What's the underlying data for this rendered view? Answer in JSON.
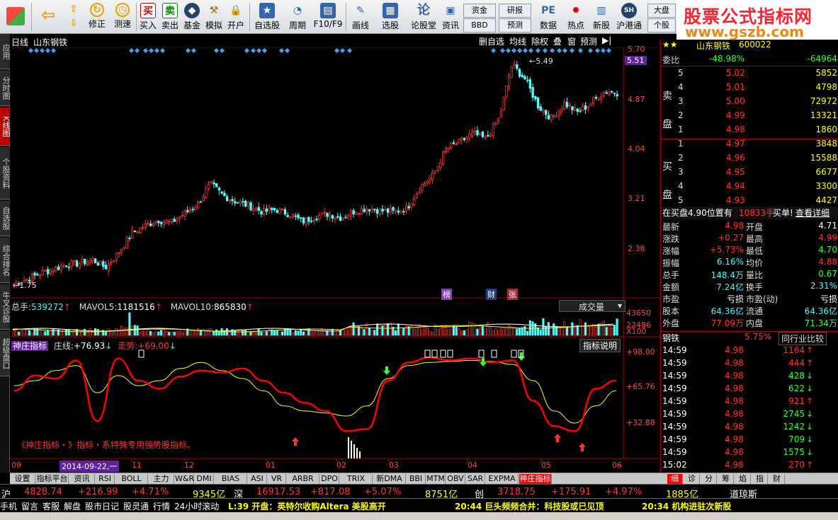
{
  "toolbar": {
    "items": [
      {
        "label": "修正",
        "icon": "refresh-icon"
      },
      {
        "label": "测速",
        "icon": "clock-icon"
      },
      {
        "label": "买入",
        "icon": "buy-icon",
        "glyph": "买"
      },
      {
        "label": "卖出",
        "icon": "sell-icon",
        "glyph": "卖"
      },
      {
        "label": "基金",
        "icon": "fund-icon"
      },
      {
        "label": "模拟",
        "icon": "hammer-icon"
      },
      {
        "label": "开户",
        "icon": "lock-icon"
      },
      {
        "label": "自选股",
        "icon": "star-icon"
      },
      {
        "label": "周期",
        "icon": "cycle-icon"
      },
      {
        "label": "F10/F9",
        "icon": "f10-icon"
      },
      {
        "label": "画线",
        "icon": "pen-icon"
      },
      {
        "label": "选股",
        "icon": "select-icon"
      },
      {
        "label": "论股堂",
        "icon": "forum-icon",
        "glyph": "论"
      },
      {
        "label": "资讯",
        "icon": "news-icon"
      },
      {
        "label": "数据",
        "icon": "data-icon"
      },
      {
        "label": "热点",
        "icon": "hot-icon"
      },
      {
        "label": "新股",
        "icon": "newstock-icon"
      },
      {
        "label": "沪港通",
        "icon": "hk-icon"
      }
    ],
    "small_buttons": {
      "zijin": "资金",
      "bbd": "BBD",
      "yanbao": "研报",
      "yuce": "预测",
      "dapan": "大盘",
      "gegu": "个股"
    }
  },
  "ad": {
    "title": "股票公式指标网",
    "url": "www.gszb.com"
  },
  "side_tabs": [
    "应用",
    "分时图",
    "K线图",
    "个股资料",
    "自选股",
    "综合排名",
    "牛叉诊股",
    "超级盘口"
  ],
  "chart": {
    "header": {
      "period": "日线",
      "stock_name": "山东钢铁",
      "buttons": [
        "删自选",
        "均线",
        "除权",
        "叠",
        "窗",
        "预测"
      ]
    },
    "price_ticks": [
      "5.70",
      "4.87",
      "4.04",
      "3.21",
      "2.38"
    ],
    "price_flag": "5.51",
    "high_mark": "5.49",
    "low_mark": "1.75",
    "badges": [
      {
        "text": "榜",
        "color": "#8040c0"
      },
      {
        "text": "财",
        "color": "#204080"
      },
      {
        "text": "张",
        "color": "#a03040"
      }
    ],
    "volume": {
      "total_label": "总手:",
      "total": "539272",
      "ma5_label": "MAVOL5:",
      "ma5": "1181516",
      "ma10_label": "MAVOL10:",
      "ma10": "865830",
      "select": "成交量",
      "ticks": [
        "43650",
        "22486",
        "X100"
      ]
    },
    "indicator": {
      "name": "神庄指标",
      "line1_label": "庄线:",
      "line1": "+76.93",
      "line2_label": "走势:",
      "line2": "+69.00",
      "help": "指标说明",
      "ticks": [
        "+98.00",
        "+65.76",
        "+32.88"
      ],
      "note": "《神庄指标・》指标・系特殊专用强势股指标。"
    },
    "x_ticks": [
      "09",
      "11",
      "12",
      "01",
      "02",
      "03",
      "04",
      "05",
      "06"
    ],
    "cursor_date": "2014-09-22,一",
    "colors": {
      "up": "#ff3232",
      "down": "#54fcfc",
      "signal": "#40a0ff"
    }
  },
  "chart_data": {
    "type": "candlestick",
    "stock": "山东钢铁",
    "price_axis": [
      1.75,
      5.7
    ],
    "price_labels": [
      5.7,
      4.87,
      4.04,
      3.21,
      2.38
    ],
    "high": 5.49,
    "low": 1.75,
    "months": [
      "09",
      "11",
      "12",
      "01",
      "02",
      "03",
      "04",
      "05",
      "06"
    ],
    "close_path": [
      1.78,
      1.85,
      1.95,
      2.02,
      2.1,
      2.12,
      2.18,
      2.05,
      2.3,
      2.62,
      2.75,
      2.85,
      2.8,
      2.95,
      3.1,
      3.45,
      3.25,
      3.15,
      3.08,
      2.98,
      3.02,
      2.95,
      2.82,
      2.9,
      2.95,
      2.88,
      3.0,
      3.05,
      3.0,
      2.98,
      3.05,
      3.4,
      3.6,
      4.05,
      4.15,
      4.3,
      4.2,
      4.55,
      5.45,
      5.2,
      4.75,
      4.55,
      4.8,
      4.65,
      4.8,
      5.0,
      4.98
    ],
    "indicator": {
      "name": "神庄指标",
      "range": [
        0,
        98
      ],
      "zhuang": [
        60,
        75,
        72,
        90,
        30,
        92,
        70,
        62,
        74,
        80,
        78,
        82,
        70,
        58,
        48,
        40,
        20,
        22,
        70,
        88,
        93,
        90,
        92,
        88,
        90,
        50,
        25,
        20,
        62,
        70
      ],
      "zoushi": [
        65,
        70,
        80,
        85,
        58,
        75,
        65,
        70,
        82,
        88,
        80,
        72,
        60,
        45,
        40,
        38,
        35,
        45,
        72,
        85,
        88,
        89,
        90,
        89,
        86,
        70,
        40,
        28,
        45,
        60
      ]
    }
  },
  "quote": {
    "name": "山东钢铁",
    "code": "600022",
    "weibi_label": "委比",
    "weibi": "-48.98%",
    "weicha": "-64964",
    "sell_label": [
      "卖",
      "盘"
    ],
    "buy_label": [
      "买",
      "盘"
    ],
    "sells": [
      {
        "lvl": "5",
        "price": "5.02",
        "vol": "5852"
      },
      {
        "lvl": "4",
        "price": "5.01",
        "vol": "4798"
      },
      {
        "lvl": "3",
        "price": "5.00",
        "vol": "72972"
      },
      {
        "lvl": "2",
        "price": "4.99",
        "vol": "13321"
      },
      {
        "lvl": "1",
        "price": "4.98",
        "vol": "1860"
      }
    ],
    "buys": [
      {
        "lvl": "1",
        "price": "4.97",
        "vol": "3848"
      },
      {
        "lvl": "2",
        "price": "4.96",
        "vol": "15588"
      },
      {
        "lvl": "3",
        "price": "4.95",
        "vol": "6677"
      },
      {
        "lvl": "4",
        "price": "4.94",
        "vol": "3300"
      },
      {
        "lvl": "5",
        "price": "4.93",
        "vol": "4427"
      }
    ],
    "buy_note": "在买盘4.90位置有",
    "buy_note_vol": "10833手",
    "buy_note_tail": "买单!",
    "detail_link": "查看详细",
    "stats": [
      {
        "k1": "最新",
        "v1": "4.98",
        "c1": "red",
        "k2": "开盘",
        "v2": "4.71",
        "c2": "white"
      },
      {
        "k1": "涨跌",
        "v1": "+0.27",
        "c1": "red",
        "k2": "最高",
        "v2": "4.99",
        "c2": "red"
      },
      {
        "k1": "涨幅",
        "v1": "+5.73%",
        "c1": "red",
        "k2": "最低",
        "v2": "4.70",
        "c2": "green"
      },
      {
        "k1": "振幅",
        "v1": "6.16%",
        "c1": "cyan",
        "k2": "均价",
        "v2": "4.88",
        "c2": "red"
      },
      {
        "k1": "总手",
        "v1": "148.4万",
        "c1": "cyan",
        "k2": "量比",
        "v2": "0.67",
        "c2": "green"
      },
      {
        "k1": "金额",
        "v1": "7.24亿",
        "c1": "cyan",
        "k2": "换手",
        "v2": "2.31%",
        "c2": "cyan"
      },
      {
        "k1": "市盈",
        "v1": "亏损",
        "c1": "white",
        "k2": "市盈(动)",
        "v2": "亏损",
        "c2": "white"
      },
      {
        "k1": "股本",
        "v1": "64.36亿",
        "c1": "cyan",
        "k2": "流通",
        "v2": "64.36亿",
        "c2": "cyan"
      },
      {
        "k1": "外盘",
        "v1": "77.09万",
        "c1": "red",
        "k2": "内盘",
        "v2": "71.34万",
        "c2": "green"
      }
    ],
    "sector": {
      "name": "钢铁",
      "pct": "5.75%",
      "btn": "同行业比较"
    },
    "ticks": [
      {
        "t": "14:59",
        "p": "4.98",
        "v": "1164",
        "d": "up"
      },
      {
        "t": "14:59",
        "p": "4.98",
        "v": "444",
        "d": "up"
      },
      {
        "t": "14:59",
        "p": "4.98",
        "v": "428",
        "d": "down"
      },
      {
        "t": "14:59",
        "p": "4.98",
        "v": "622",
        "d": "down"
      },
      {
        "t": "14:59",
        "p": "4.98",
        "v": "921",
        "d": "up"
      },
      {
        "t": "14:59",
        "p": "4.98",
        "v": "2745",
        "d": "down"
      },
      {
        "t": "14:59",
        "p": "4.98",
        "v": "1242",
        "d": "down"
      },
      {
        "t": "14:59",
        "p": "4.98",
        "v": "709",
        "d": "down"
      },
      {
        "t": "14:59",
        "p": "4.98",
        "v": "1575",
        "d": "down"
      },
      {
        "t": "15:02",
        "p": "4.98",
        "v": "270",
        "d": "up"
      }
    ]
  },
  "bottom_tabs": [
    "设置",
    "指标平台",
    "资讯",
    "RSI",
    "BOLL",
    "主力",
    "W&R",
    "DMI",
    "BIAS",
    "ASI",
    "VR",
    "ARBR",
    "DPO",
    "TRIX",
    "新DMA",
    "BBI",
    "MTM",
    "OBV",
    "SAR",
    "EXPMA",
    "神庄指标"
  ],
  "right_tabs": [
    "细",
    "诊",
    "分",
    "筹",
    "焰",
    "指",
    "财"
  ],
  "indices": [
    {
      "name": "沪",
      "value": "4828.74",
      "chg": "+216.99",
      "pct": "+4.71%",
      "amt": "9345亿"
    },
    {
      "name": "深",
      "value": "16917.53",
      "chg": "+817.08",
      "pct": "+5.07%",
      "amt": "8751亿"
    },
    {
      "name": "创",
      "value": "3718.75",
      "chg": "+175.91",
      "pct": "+4.97%",
      "amt": "1885亿"
    },
    {
      "name": "道琼斯"
    }
  ],
  "ticker": {
    "tabs": [
      "手机",
      "留言",
      "客服",
      "解盘",
      "股市日记",
      "股灵通",
      "行情",
      "24小时滚动"
    ],
    "news": [
      "L:39 开盘：英特尔收购Altera 美股高开",
      "20:44 巨头频频合并：科技股或已见顶",
      "20:34 机构进驻次新股"
    ]
  }
}
